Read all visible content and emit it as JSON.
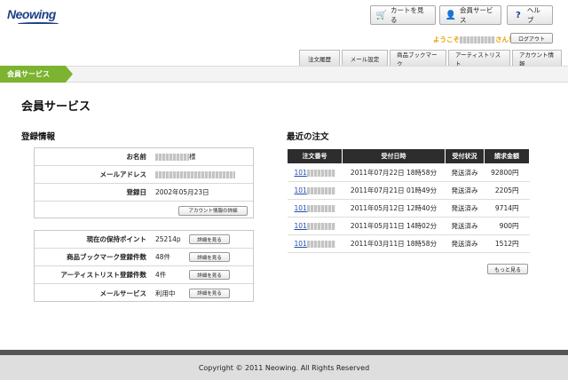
{
  "brand": {
    "logo": "Neowing"
  },
  "header": {
    "buttons": [
      {
        "label": "カートを見る",
        "icon": "cart-icon"
      },
      {
        "label": "会員サービス",
        "icon": "person-icon"
      },
      {
        "label": "ヘルプ",
        "icon": "question-icon"
      }
    ],
    "welcome_prefix": "ようこそ",
    "welcome_suffix": "さん!",
    "logout": "ログアウト"
  },
  "tabs": [
    "注文履歴",
    "メール設定",
    "商品ブックマーク",
    "アーティストリスト",
    "アカウント情報"
  ],
  "breadcrumb": "会員サービス",
  "page_title": "会員サービス",
  "registration": {
    "heading": "登録情報",
    "name_label": "お名前",
    "name_suffix": "様",
    "email_label": "メールアドレス",
    "date_label": "登録日",
    "date_value": "2002年05月23日",
    "account_button": "アカウント情報の詳細",
    "points_label": "現在の保持ポイント",
    "points_value": "25214p",
    "bookmark_label": "商品ブックマーク登録件数",
    "bookmark_value": "48件",
    "artist_label": "アーティストリスト登録件数",
    "artist_value": "4件",
    "mail_label": "メールサービス",
    "mail_value": "利用中",
    "detail_button": "詳細を見る"
  },
  "orders": {
    "heading": "最近の注文",
    "columns": [
      "注文番号",
      "受付日時",
      "受付状況",
      "請求金額"
    ],
    "rows": [
      {
        "no": "101",
        "date": "2011年07月22日 18時58分",
        "status": "発送済み",
        "amount": "92800円"
      },
      {
        "no": "101",
        "date": "2011年07月21日 01時49分",
        "status": "発送済み",
        "amount": "2205円"
      },
      {
        "no": "101",
        "date": "2011年05月12日 12時40分",
        "status": "発送済み",
        "amount": "9714円"
      },
      {
        "no": "101",
        "date": "2011年05月11日 14時02分",
        "status": "発送済み",
        "amount": "900円"
      },
      {
        "no": "101",
        "date": "2011年03月11日 18時58分",
        "status": "発送済み",
        "amount": "1512円"
      }
    ],
    "more_button": "もっと見る"
  },
  "footer": "Copyright © 2011 Neowing. All Rights Reserved"
}
